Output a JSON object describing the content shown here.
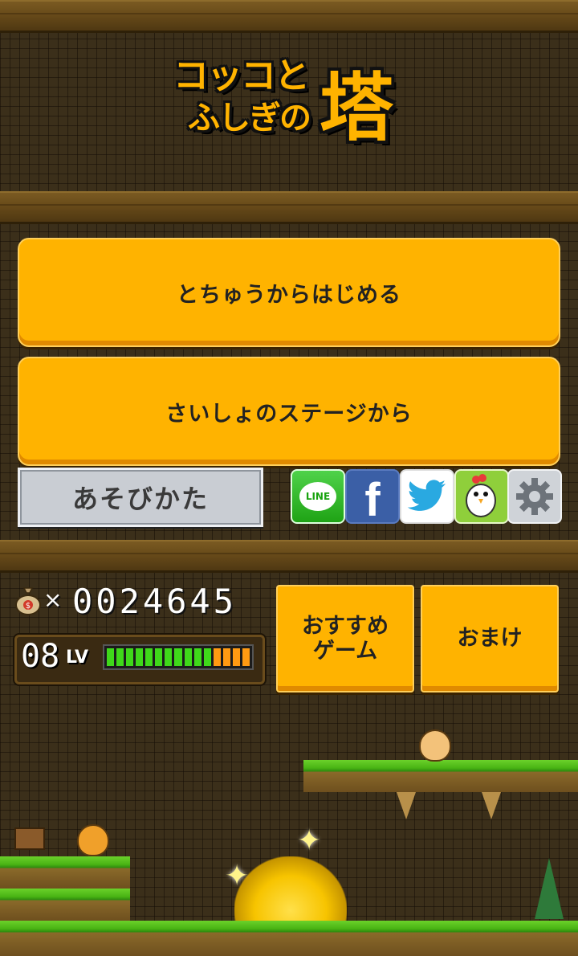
{
  "title": {
    "line1": "コッコと",
    "line2": "ふしぎの",
    "big": "塔"
  },
  "menu": {
    "continue_label": "とちゅうからはじめる",
    "first_stage_label": "さいしょのステージから",
    "how_to_play_label": "あそびかた"
  },
  "social": {
    "line_label": "LINE",
    "facebook_glyph": "f"
  },
  "stats": {
    "coin_symbol": "$",
    "times": "×",
    "coins": "0024645",
    "level": "08",
    "level_label": "LV",
    "exp_fraction": 0.75
  },
  "buttons": {
    "recommended_games": "おすすめ\nゲーム",
    "bonus": "おまけ"
  },
  "colors": {
    "button": "#ffb300",
    "bar_green": "#3fd81a",
    "bar_orange": "#ff9a12"
  }
}
